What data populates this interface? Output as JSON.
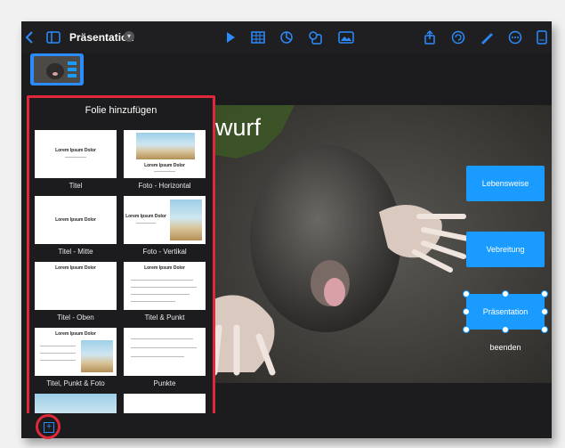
{
  "toolbar": {
    "title": "Präsentation",
    "icons": [
      "back-icon",
      "sidebar-icon",
      "title-chevron-icon",
      "play-icon",
      "table-icon",
      "chart-icon",
      "shapes-icon",
      "media-icon",
      "share-icon",
      "undo-icon",
      "format-brush-icon",
      "more-icon",
      "document-icon"
    ]
  },
  "slide": {
    "title_fragment": "lwurf",
    "buttons": [
      "Lebensweise",
      "Vebreitung",
      "Präsentation beenden"
    ]
  },
  "popover": {
    "title": "Folie hinzufügen",
    "layouts": [
      {
        "label": "Titel",
        "card_text": "Lorem Ipsum Dolor"
      },
      {
        "label": "Foto - Horizontal",
        "card_text": "Lorem Ipsum Dolor"
      },
      {
        "label": "Titel - Mitte",
        "card_text": "Lorem Ipsum Dolor"
      },
      {
        "label": "Foto - Vertikal",
        "card_text": "Lorem Ipsum Dolor"
      },
      {
        "label": "Titel - Oben",
        "card_text": "Lorem Ipsum Dolor"
      },
      {
        "label": "Titel & Punkt",
        "card_text": "Lorem Ipsum Dolor"
      },
      {
        "label": "Titel, Punkt & Foto",
        "card_text": "Lorem Ipsum Dolor"
      },
      {
        "label": "Punkte",
        "card_text": ""
      }
    ]
  },
  "colors": {
    "accent": "#2b8cff",
    "highlight": "#e0283a",
    "slide_button": "#1a9bff"
  }
}
